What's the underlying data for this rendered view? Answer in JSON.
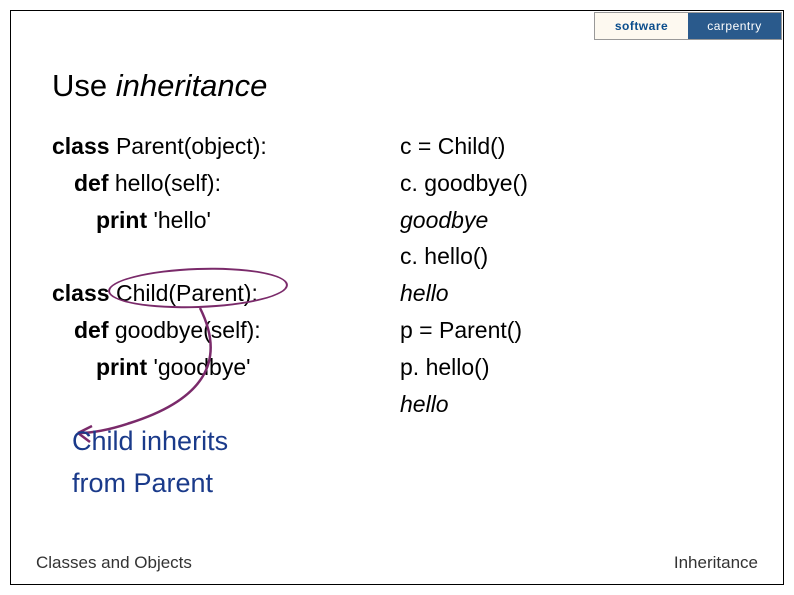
{
  "logo": {
    "left": "software",
    "right": "carpentry"
  },
  "heading": {
    "use": "Use ",
    "inh": "inheritance"
  },
  "code": {
    "left": [
      {
        "cls": "",
        "kw": "class",
        "rest": " Parent(object):"
      },
      {
        "cls": "ind1",
        "kw": "def",
        "rest": " hello(self):"
      },
      {
        "cls": "ind2",
        "kw": "print",
        "rest": " 'hello'"
      },
      {
        "cls": "",
        "kw": "",
        "rest": " "
      },
      {
        "cls": "",
        "kw": "class",
        "rest": " Child(Parent):"
      },
      {
        "cls": "ind1",
        "kw": "def",
        "rest": " goodbye(self):"
      },
      {
        "cls": "ind2",
        "kw": "print",
        "rest": " 'goodbye'"
      }
    ],
    "right": [
      {
        "text": "c = Child()",
        "italic": false
      },
      {
        "text": "c. goodbye()",
        "italic": false
      },
      {
        "text": "goodbye",
        "italic": true
      },
      {
        "text": "c. hello()",
        "italic": false
      },
      {
        "text": "hello",
        "italic": true
      },
      {
        "text": "p = Parent()",
        "italic": false
      },
      {
        "text": "p. hello()",
        "italic": false
      },
      {
        "text": "hello",
        "italic": true
      }
    ]
  },
  "note": {
    "line1": "Child inherits",
    "line2": "from Parent"
  },
  "footer": {
    "left": "Classes and Objects",
    "right": "Inheritance"
  },
  "colors": {
    "annotation": "#7a2a6a",
    "note": "#1a3a8a"
  }
}
